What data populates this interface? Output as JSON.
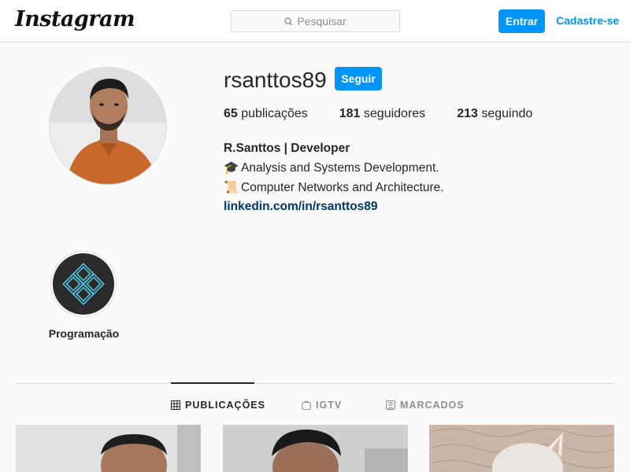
{
  "nav": {
    "logo": "Instagram",
    "search_placeholder": "Pesquisar",
    "entrar_label": "Entrar",
    "cadastre_label": "Cadastre-se"
  },
  "profile": {
    "username": "rsanttos89",
    "follow_label": "Seguir",
    "stats": [
      {
        "count": "65",
        "label": "publicações"
      },
      {
        "count": "181",
        "label": "seguidores"
      },
      {
        "count": "213",
        "label": "seguindo"
      }
    ],
    "bio": {
      "name": "R.Santtos | Developer",
      "line1_icon": "🎓",
      "line1": "Analysis and Systems Development.",
      "line2_icon": "📜",
      "line2": "Computer Networks and Architecture.",
      "link": "linkedin.com/in/rsanttos89"
    }
  },
  "highlights": [
    {
      "label": "Programação",
      "icon": "diamond-pattern-icon"
    }
  ],
  "tabs": [
    {
      "label": "PUBLICAÇÕES",
      "icon": "grid-icon",
      "active": true
    },
    {
      "label": "IGTV",
      "icon": "igtv-icon",
      "active": false
    },
    {
      "label": "MARCADOS",
      "icon": "tagged-icon",
      "active": false
    }
  ],
  "colors": {
    "accent": "#0095f6",
    "link": "#00376b",
    "text": "#262626",
    "muted": "#8e8e8e",
    "background": "#fafafa"
  }
}
